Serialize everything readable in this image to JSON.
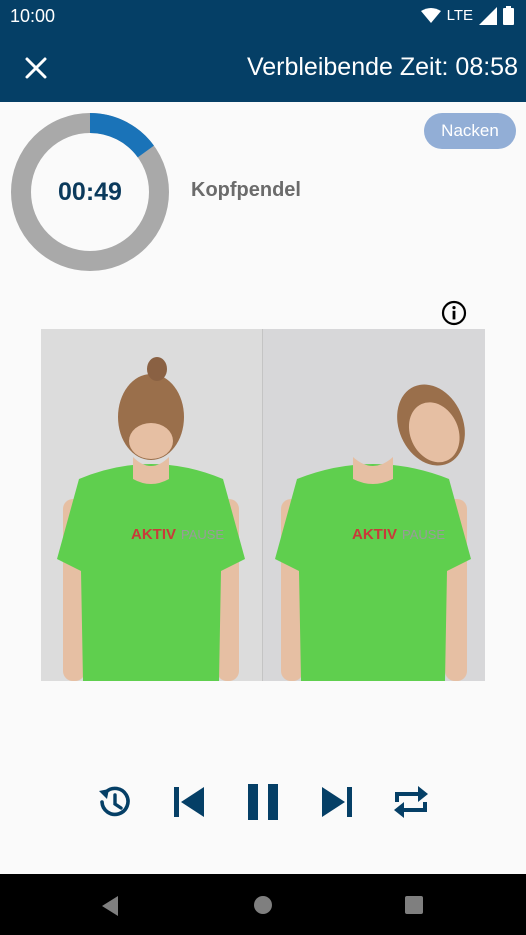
{
  "status_bar": {
    "time": "10:00",
    "network": "LTE",
    "icons": [
      "wifi-icon",
      "signal-icon",
      "battery-icon"
    ]
  },
  "app_bar": {
    "close_icon": "close-icon",
    "title": "Verbleibende Zeit: 08:58"
  },
  "timer": {
    "display": "00:49",
    "progress_fraction": 0.15
  },
  "exercise": {
    "name": "Kopfpendel",
    "category": "Nacken",
    "info_icon": "info-icon",
    "photo_logo_text": "AKTIV PAUSE"
  },
  "controls": [
    "restart-timer-icon",
    "skip-previous-icon",
    "pause-icon",
    "skip-next-icon",
    "repeat-icon"
  ],
  "nav_bar": [
    "back-icon",
    "home-icon",
    "recents-icon"
  ],
  "colors": {
    "primary": "#053f66",
    "progress": "#1a73b8",
    "progress_track": "#a9a9a9",
    "chip": "#92aed6",
    "shirt": "#5fcf4e"
  }
}
